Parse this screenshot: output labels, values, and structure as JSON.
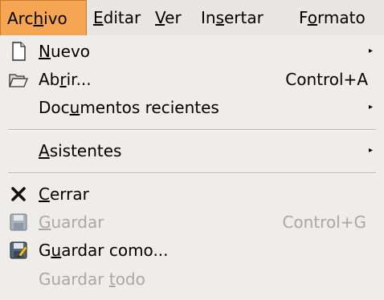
{
  "menubar": {
    "items": [
      {
        "pre": "Arc",
        "u": "h",
        "post": "ivo"
      },
      {
        "pre": "",
        "u": "E",
        "post": "ditar"
      },
      {
        "pre": "",
        "u": "V",
        "post": "er"
      },
      {
        "pre": "In",
        "u": "s",
        "post": "ertar"
      },
      {
        "pre": "F",
        "u": "o",
        "post": "rmato"
      }
    ]
  },
  "menu": {
    "nuevo": {
      "pre": "",
      "u": "N",
      "post": "uevo"
    },
    "abrir": {
      "pre": "Ab",
      "u": "r",
      "post": "ir...",
      "accel": "Control+A"
    },
    "recientes": {
      "pre": "Doc",
      "u": "u",
      "post": "mentos recientes"
    },
    "asistentes": {
      "pre": "",
      "u": "A",
      "post": "sistentes"
    },
    "cerrar": {
      "pre": "",
      "u": "C",
      "post": "errar"
    },
    "guardar": {
      "pre": "",
      "u": "G",
      "post": "uardar",
      "accel": "Control+G"
    },
    "guardar_como": {
      "pre": "G",
      "u": "u",
      "post": "ardar como..."
    },
    "guardar_todo": {
      "pre": "Guardar ",
      "u": "t",
      "post": "odo"
    }
  },
  "submenu_arrow": "▸",
  "icons": {
    "nuevo": "new-document-icon",
    "abrir": "open-folder-icon",
    "cerrar": "close-x-icon",
    "guardar": "save-disk-icon",
    "guardar_como": "save-as-icon"
  },
  "colors": {
    "active_menu_bg": "#f6a652",
    "disabled_text": "#aaa8a4"
  }
}
